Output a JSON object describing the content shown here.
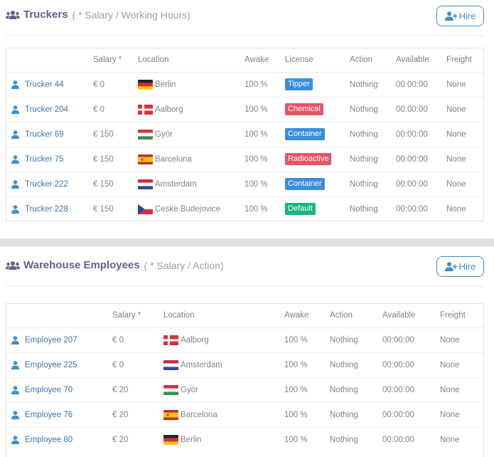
{
  "colors": {
    "accent": "#3e8ecb",
    "title": "#6b5b86",
    "link": "#3b76ad",
    "tipper": "#3a8dde",
    "chemical": "#e65566",
    "container": "#3a8dde",
    "radioactive": "#e65566",
    "default": "#18b57c"
  },
  "truckers": {
    "title": "Truckers",
    "subtitle": "( * Salary / Working Hours)",
    "hire_label": "Hire",
    "columns": [
      "",
      "",
      "Salary *",
      "Location",
      "Awake",
      "License",
      "Action",
      "Available",
      "Freight"
    ],
    "rows": [
      {
        "name": "Trucker 44",
        "salary": "€ 0",
        "flag": "germany",
        "location": "Berlin",
        "awake": "100 %",
        "license": "Tipper",
        "license_color": "#3a8dde",
        "action": "Nothing",
        "available": "00:00:00",
        "freight": "None"
      },
      {
        "name": "Trucker 204",
        "salary": "€ 0",
        "flag": "denmark",
        "location": "Aalborg",
        "awake": "100 %",
        "license": "Chemical",
        "license_color": "#e65566",
        "action": "Nothing",
        "available": "00:00:00",
        "freight": "None"
      },
      {
        "name": "Trucker 69",
        "salary": "€ 150",
        "flag": "hungary",
        "location": "Györ",
        "awake": "100 %",
        "license": "Container",
        "license_color": "#3a8dde",
        "action": "Nothing",
        "available": "00:00:00",
        "freight": "None"
      },
      {
        "name": "Trucker 75",
        "salary": "€ 150",
        "flag": "spain",
        "location": "Barcelona",
        "awake": "100 %",
        "license": "Radioactive",
        "license_color": "#e65566",
        "action": "Nothing",
        "available": "00:00:00",
        "freight": "None"
      },
      {
        "name": "Trucker 222",
        "salary": "€ 150",
        "flag": "netherlands",
        "location": "Amsterdam",
        "awake": "100 %",
        "license": "Container",
        "license_color": "#3a8dde",
        "action": "Nothing",
        "available": "00:00:00",
        "freight": "None"
      },
      {
        "name": "Trucker 228",
        "salary": "€ 150",
        "flag": "czech",
        "location": "Ceske Budejovice",
        "awake": "100 %",
        "license": "Default",
        "license_color": "#18b57c",
        "action": "Nothing",
        "available": "00:00:00",
        "freight": "None"
      }
    ]
  },
  "warehouse": {
    "title": "Warehouse Employees",
    "subtitle": "( * Salary / Action)",
    "hire_label": "Hire",
    "columns": [
      "",
      "",
      "Salary *",
      "Location",
      "Awake",
      "Action",
      "Available",
      "Freight"
    ],
    "rows": [
      {
        "name": "Employee 207",
        "salary": "€ 0",
        "flag": "denmark",
        "location": "Aalborg",
        "awake": "100 %",
        "action": "Nothing",
        "available": "00:00:00",
        "freight": "None"
      },
      {
        "name": "Employee 225",
        "salary": "€ 0",
        "flag": "netherlands",
        "location": "Amsterdam",
        "awake": "100 %",
        "action": "Nothing",
        "available": "00:00:00",
        "freight": "None"
      },
      {
        "name": "Employee 70",
        "salary": "€ 20",
        "flag": "hungary",
        "location": "Györ",
        "awake": "100 %",
        "action": "Nothing",
        "available": "00:00:00",
        "freight": "None"
      },
      {
        "name": "Employee 76",
        "salary": "€ 20",
        "flag": "spain",
        "location": "Barcelona",
        "awake": "100 %",
        "action": "Nothing",
        "available": "00:00:00",
        "freight": "None"
      },
      {
        "name": "Employee 80",
        "salary": "€ 20",
        "flag": "germany",
        "location": "Berlin",
        "awake": "100 %",
        "action": "Nothing",
        "available": "00:00:00",
        "freight": "None"
      }
    ]
  }
}
